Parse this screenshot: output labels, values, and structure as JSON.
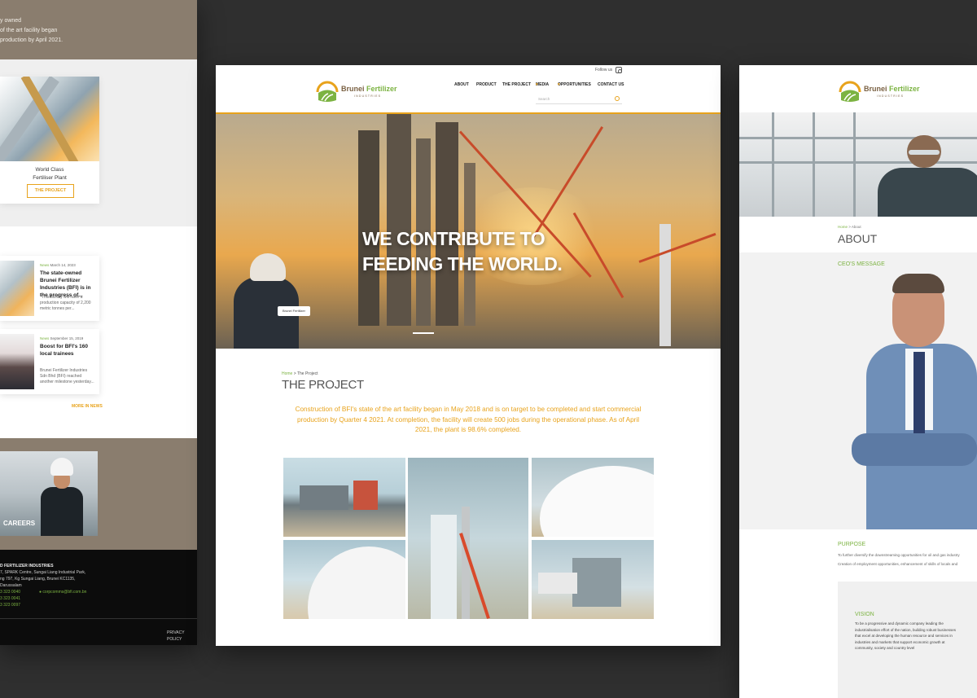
{
  "brand": {
    "name_part1": "Brunei",
    "name_part2": "Fertilizer",
    "sub": "INDUSTRIES",
    "colors": {
      "green": "#7cb342",
      "gold": "#e8a31c",
      "brown": "#7b6244",
      "taupe": "#8a7d6e"
    }
  },
  "left": {
    "top_text": [
      "y owned",
      "of the art facility began",
      "production by April 2021."
    ],
    "card": {
      "caption_line1": "World Class",
      "caption_line2": "Fertiliser Plant",
      "button": "THE PROJECT"
    },
    "news": [
      {
        "tag": "News",
        "date": "March 14, 2023",
        "title": "The state-owned Brunei Fertilizer Industries (BFI) is in the progress of...",
        "excerpt": "\"This factory will have a production capacity of 2,200 metric tonnes per..."
      },
      {
        "tag": "News",
        "date": "September 15, 2019",
        "title": "Boost for BFI's 160 local trainees",
        "excerpt": "Brunei Fertilizer Industries Sdn Bhd (BFI) reached another milestone yesterday..."
      }
    ],
    "more_news": "MORE IN NEWS",
    "careers_label": "CAREERS",
    "footer": {
      "company": "D FERTILIZER INDUSTRIES",
      "address1": "7, SPARK Centre, Sungai Liang Industrial Park,",
      "address2": "ng 797, Kg Sungai Liang, Brunei KC1135,",
      "address3": "Darussalam",
      "phone1": "3 323 0040",
      "phone2": "3 323 0041",
      "phone3": "3 323 0097",
      "email": "corpcomms@bfi.com.bn",
      "privacy": "PRIVACY POLICY"
    }
  },
  "center": {
    "follow_label": "Follow us",
    "nav": [
      "ABOUT",
      "PRODUCT",
      "THE PROJECT",
      "MEDIA",
      "OPPORTUNITIES",
      "CONTACT US"
    ],
    "search_placeholder": "Search",
    "hero_line1": "WE CONTRIBUTE TO",
    "hero_line2": "FEEDING THE WORLD.",
    "badge_text": "Brunei Fertilizer",
    "breadcrumb_home": "Home",
    "breadcrumb_rest": " > The Project",
    "page_title": "THE PROJECT",
    "intro": "Construction of BFI's state of the art facility began in May 2018 and is on target to be completed and start commercial production by Quarter 4 2021. At completion, the facility will create 500 jobs during the operational phase. As of April 2021, the plant is 98.6% completed."
  },
  "right": {
    "breadcrumb_home": "Home",
    "breadcrumb_rest": " > About",
    "title": "ABOUT",
    "ceo_title": "CEO'S MESSAGE",
    "purpose_title": "PURPOSE",
    "purpose_line1": "To further diversify the downstreaming opportunities for oil and gas industry",
    "purpose_line2": "Creation of employment opportunities, enhancement of skills of locals and",
    "vision_title": "VISION",
    "vision_text": "To be a progressive and dynamic company leading the industrialisation effort of the nation, building robust businesses that excel at developing the human resource and services in industries and markets that support economic growth at community, society and country level"
  }
}
